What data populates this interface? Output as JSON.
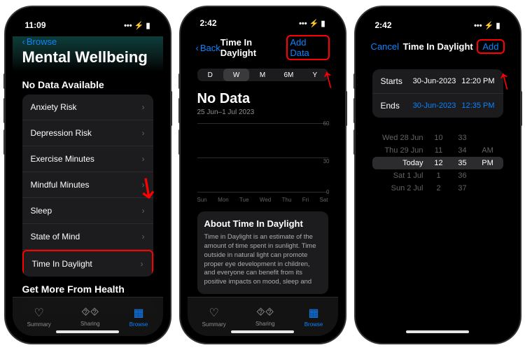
{
  "status": {
    "time1": "11:09",
    "time2": "2:42",
    "time3": "2:42",
    "icons": "••• ⚡ ▮"
  },
  "s1": {
    "back": "Browse",
    "title": "Mental Wellbeing",
    "section": "No Data Available",
    "items": [
      "Anxiety Risk",
      "Depression Risk",
      "Exercise Minutes",
      "Mindful Minutes",
      "Sleep",
      "State of Mind",
      "Time In Daylight"
    ],
    "more": "Get More From Health",
    "tabs": {
      "summary": "Summary",
      "sharing": "Sharing",
      "browse": "Browse"
    }
  },
  "s2": {
    "back": "Back",
    "title": "Time In Daylight",
    "add": "Add Data",
    "seg": [
      "D",
      "W",
      "M",
      "6M",
      "Y"
    ],
    "nodata": "No Data",
    "range": "25 Jun–1 Jul 2023",
    "ymax": "60",
    "ymid": "30",
    "ymin": "0",
    "days": [
      "Sun",
      "Mon",
      "Tue",
      "Wed",
      "Thu",
      "Fri",
      "Sat"
    ],
    "aboutTitle": "About Time In Daylight",
    "aboutBody": "Time in Daylight is an estimate of the amount of time spent in sunlight. Time outside in natural light can promote proper eye development in children, and everyone can benefit from its positive impacts on mood, sleep and"
  },
  "s3": {
    "cancel": "Cancel",
    "title": "Time In Daylight",
    "add": "Add",
    "starts": "Starts",
    "startsDate": "30-Jun-2023",
    "startsTime": "12:20 PM",
    "ends": "Ends",
    "endsDate": "30-Jun-2023",
    "endsTime": "12:35 PM",
    "picker": [
      {
        "d": "Wed 28 Jun",
        "h": "10",
        "m": "33",
        "p": ""
      },
      {
        "d": "Thu 29 Jun",
        "h": "11",
        "m": "34",
        "p": "AM"
      },
      {
        "d": "Today",
        "h": "12",
        "m": "35",
        "p": "PM"
      },
      {
        "d": "Sat 1 Jul",
        "h": "1",
        "m": "36",
        "p": ""
      },
      {
        "d": "Sun 2 Jul",
        "h": "2",
        "m": "37",
        "p": ""
      }
    ]
  }
}
